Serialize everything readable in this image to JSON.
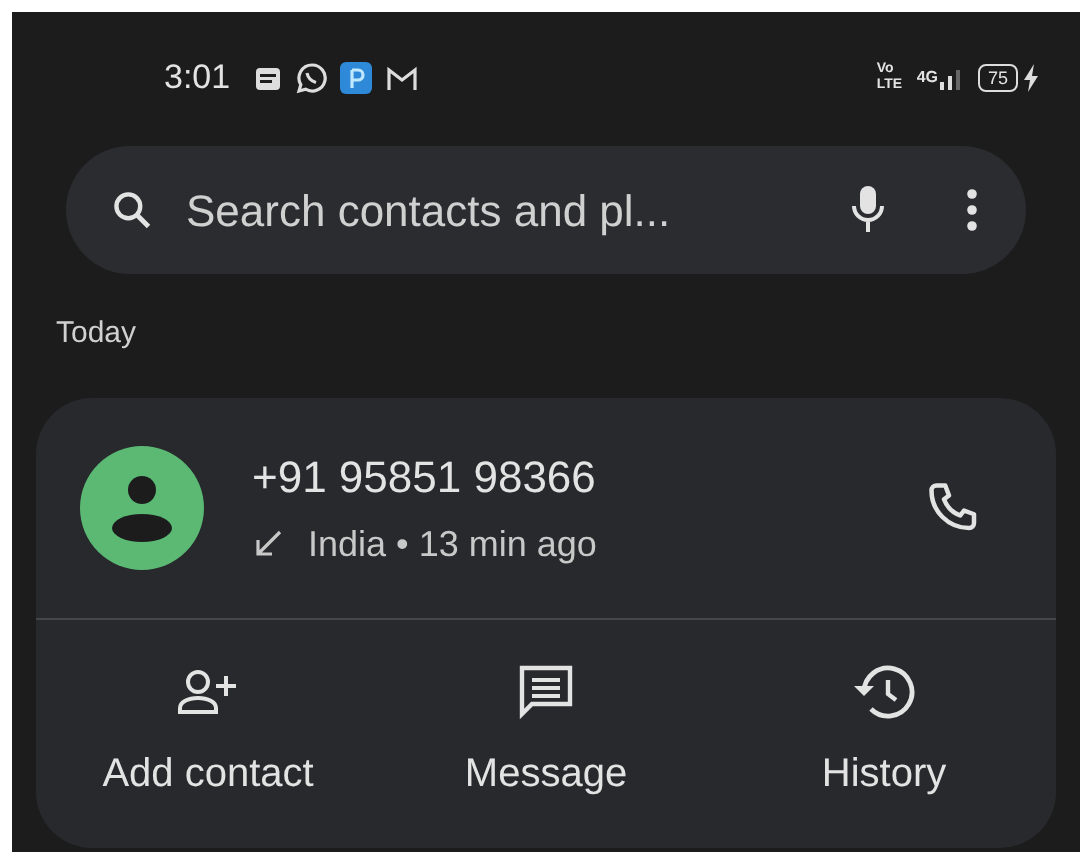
{
  "status_bar": {
    "time": "3:01",
    "volte": "Vo LTE",
    "network": "4G",
    "battery": "75",
    "charging": true
  },
  "search": {
    "placeholder": "Search contacts and pl..."
  },
  "section": "Today",
  "call": {
    "number": "+91 95851 98366",
    "incoming": true,
    "detail": "India • 13 min ago",
    "actions": [
      {
        "kind": "add-contact",
        "label": "Add contact"
      },
      {
        "kind": "message",
        "label": "Message"
      },
      {
        "kind": "history",
        "label": "History"
      }
    ]
  }
}
